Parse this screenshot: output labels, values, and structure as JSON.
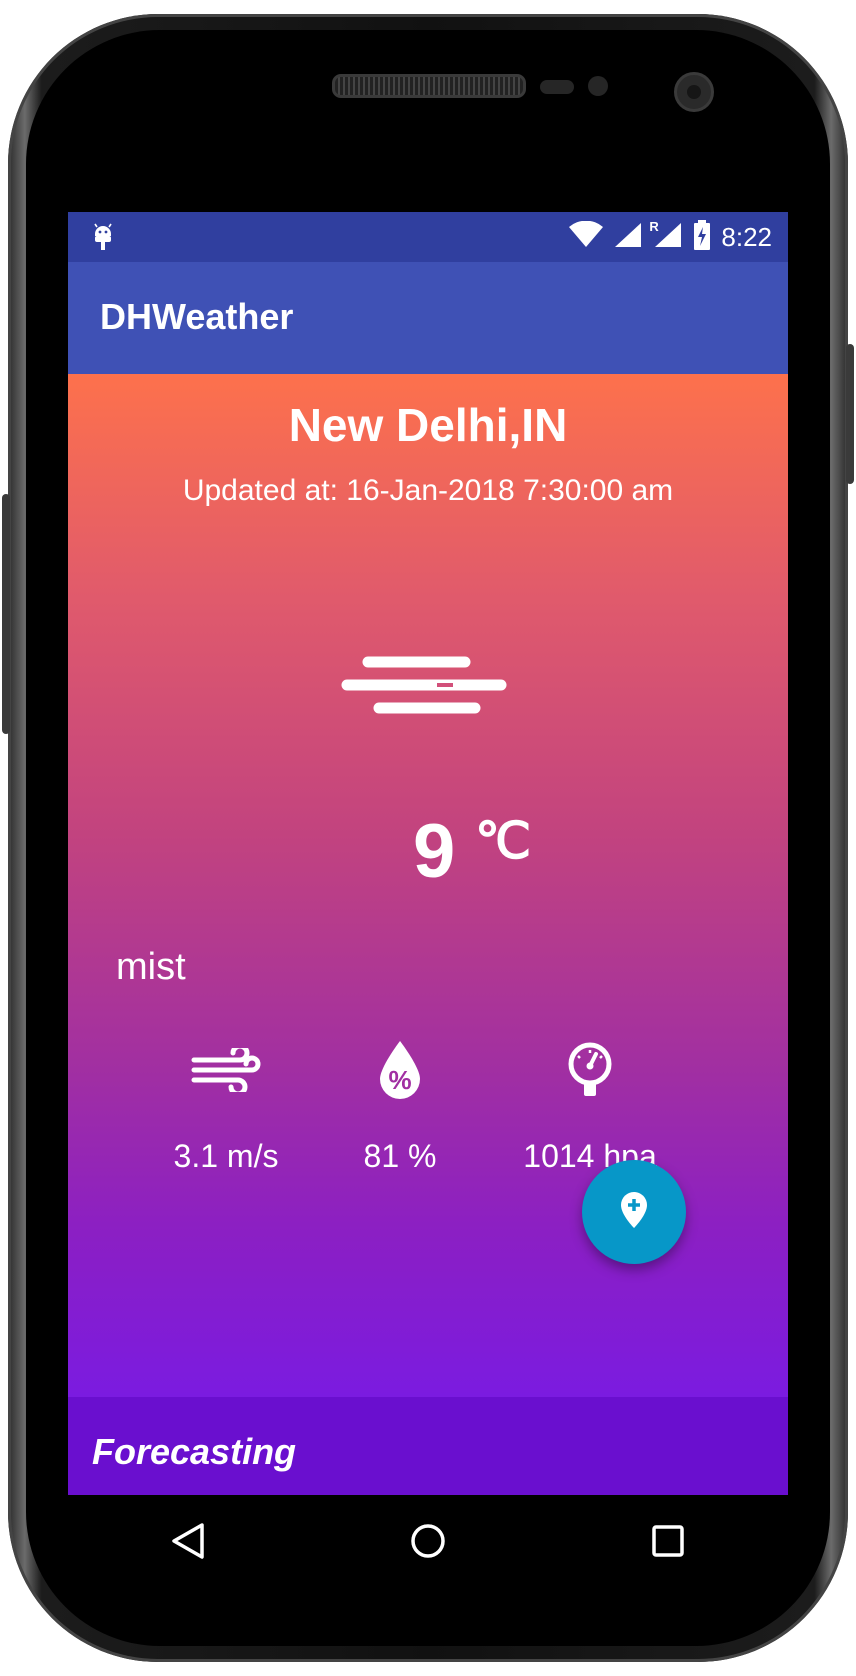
{
  "status_bar": {
    "time": "8:22",
    "icons": [
      "android-debug-icon",
      "wifi-icon",
      "signal-icon",
      "signal-roaming-icon",
      "battery-charging-icon"
    ],
    "roaming_letter": "R",
    "bg_color": "#303f9f"
  },
  "app_bar": {
    "title": "DHWeather",
    "bg_color": "#3f51b5"
  },
  "weather": {
    "city": "New Delhi,IN",
    "updated": "Updated at: 16-Jan-2018 7:30:00 am",
    "condition_icon": "mist-icon",
    "temperature": "9",
    "unit": "℃",
    "description": "mist",
    "wind": {
      "icon": "wind-icon",
      "value": "3.1 m/s"
    },
    "humidity": {
      "icon": "humidity-icon",
      "value": "81 %"
    },
    "pressure": {
      "icon": "pressure-gauge-icon",
      "value": "1014 hpa"
    }
  },
  "forecast": {
    "label": "Forecasting"
  },
  "fab": {
    "icon": "add-location-icon",
    "color": "#0797c8"
  },
  "nav_bar": {
    "buttons": [
      "back-icon",
      "home-icon",
      "recents-icon"
    ]
  },
  "colors": {
    "gradient_top": "#fd714c",
    "gradient_bottom": "#7b1be0"
  }
}
